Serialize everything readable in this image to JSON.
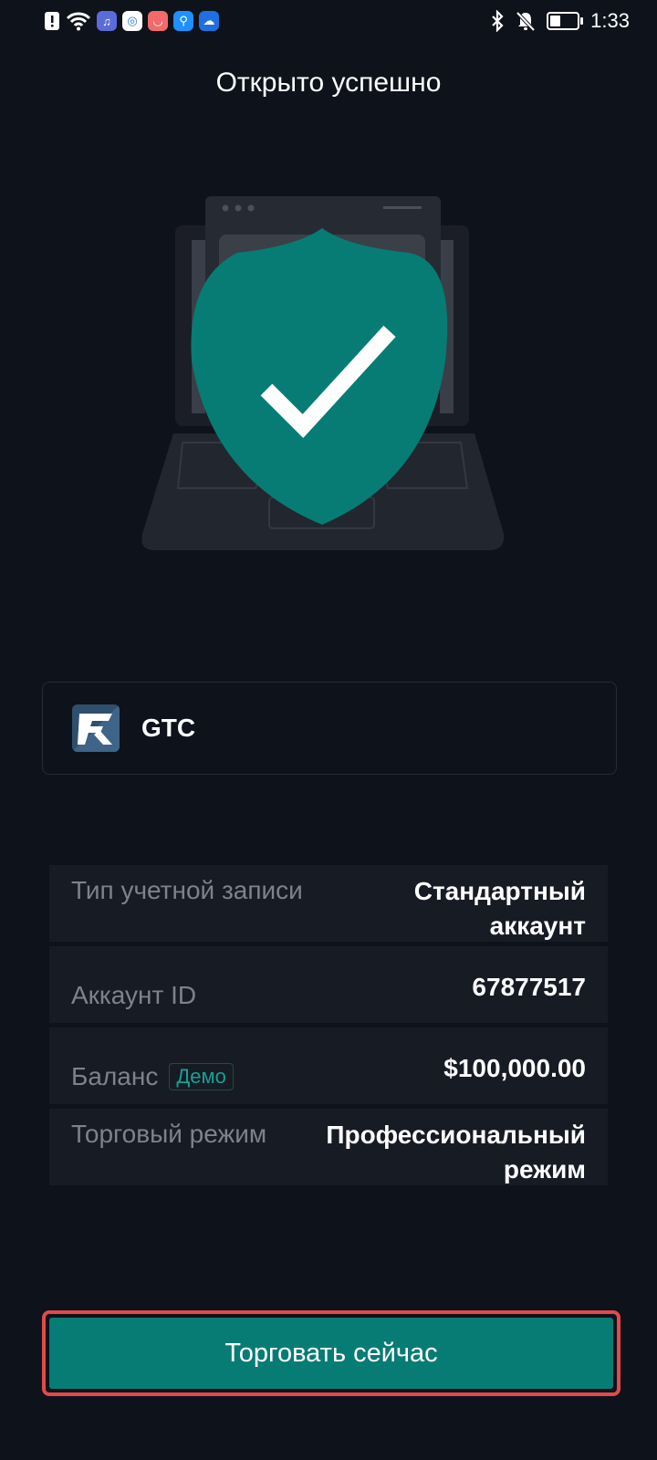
{
  "status_bar": {
    "time": "1:33",
    "left_icons": [
      "alert-icon",
      "wifi-icon",
      "music-app-icon",
      "browser-app-icon",
      "shop-app-icon",
      "search-app-icon",
      "cloud-app-icon"
    ],
    "right_icons": [
      "bluetooth-icon",
      "bell-off-icon",
      "battery-icon"
    ],
    "battery_level": 0.4
  },
  "header": {
    "title": "Открыто успешно"
  },
  "broker": {
    "name": "GTC"
  },
  "account_info": {
    "type_label": "Тип учетной записи",
    "type_value": "Стандартный аккаунт",
    "id_label": "Аккаунт ID",
    "id_value": "67877517",
    "balance_label": "Баланс",
    "balance_badge": "Демо",
    "balance_value": "$100,000.00",
    "mode_label": "Торговый режим",
    "mode_value": "Профессиональный режим"
  },
  "actions": {
    "trade_now": "Торговать сейчас"
  },
  "colors": {
    "accent": "#077c74",
    "background": "#0e121b",
    "highlight_border": "#e2494b"
  }
}
